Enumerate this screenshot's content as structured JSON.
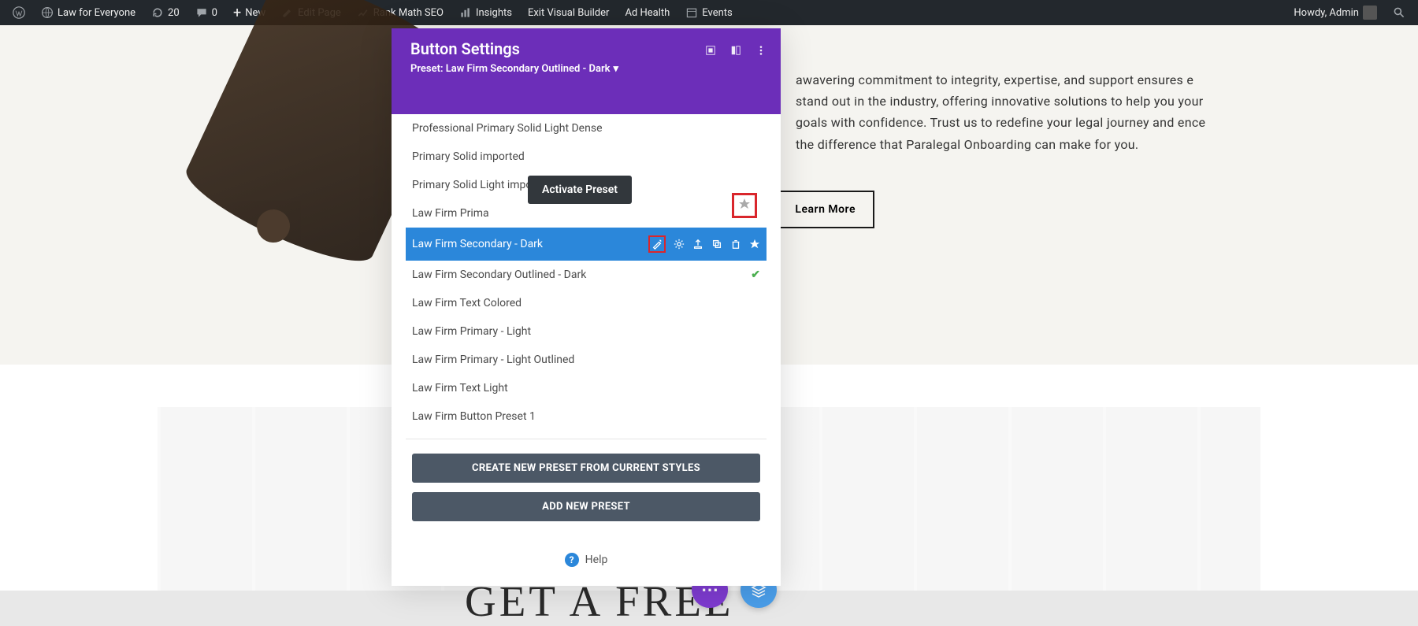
{
  "admin_bar": {
    "site": "Law for Everyone",
    "refresh": "20",
    "comments": "0",
    "new": "New",
    "edit": "Edit Page",
    "rank": "Rank Math SEO",
    "insights": "Insights",
    "exit": "Exit Visual Builder",
    "adhealth": "Ad Health",
    "events": "Events",
    "howdy": "Howdy, Admin"
  },
  "modal": {
    "title": "Button Settings",
    "preset_label": "Preset: Law Firm Secondary Outlined - Dark",
    "tooltip": "Activate Preset",
    "presets": [
      "Professional Primary Solid Light Dense",
      "Primary Solid imported",
      "Primary Solid Light imported",
      "Law Firm Prima",
      "Law Firm Secondary - Dark",
      "Law Firm Secondary Outlined - Dark",
      "Law Firm Text Colored",
      "Law Firm Primary - Light",
      "Law Firm Primary - Light Outlined",
      "Law Firm Text Light",
      "Law Firm Button Preset 1"
    ],
    "btn_create": "CREATE NEW PRESET FROM CURRENT STYLES",
    "btn_add": "ADD NEW PRESET",
    "help": "Help"
  },
  "page": {
    "body_text": "awavering commitment to integrity, expertise, and support ensures e stand out in the industry, offering innovative solutions to help you your goals with confidence. Trust us to redefine your legal journey and ence the difference that Paralegal Onboarding can make for you.",
    "learn_more": "Learn More",
    "big_title": "GET A FREE"
  }
}
